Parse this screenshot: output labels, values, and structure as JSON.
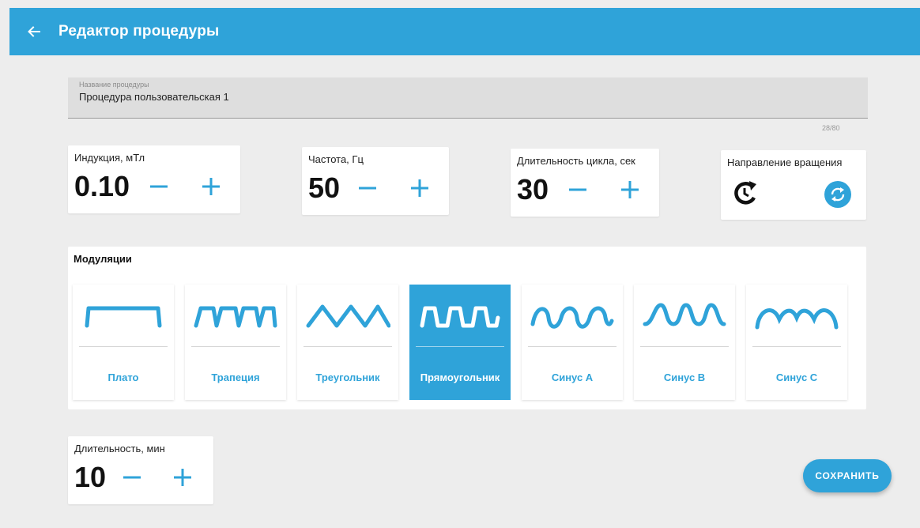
{
  "colors": {
    "accent": "#2fa3d9",
    "background": "#ededed",
    "card": "#ffffff"
  },
  "appbar": {
    "back_icon": "arrow-left-icon",
    "title": "Редактор процедуры"
  },
  "procedure_name": {
    "label": "Название процедуры",
    "value": "Процедура пользовательская 1",
    "counter": "28/80"
  },
  "params": {
    "induction": {
      "label": "Индукция, мТл",
      "value": "0.10",
      "minus": "−",
      "plus": "+"
    },
    "frequency": {
      "label": "Частота, Гц",
      "value": "50",
      "minus": "−",
      "plus": "+"
    },
    "cycle": {
      "label": "Длительность цикла, сек",
      "value": "30",
      "minus": "−",
      "plus": "+"
    },
    "rotation": {
      "label": "Направление вращения",
      "icons": [
        "rotate-clockwise-icon",
        "sync-icon"
      ]
    }
  },
  "modulations": {
    "title": "Модуляции",
    "items": [
      {
        "label": "Плато",
        "icon": "plateau-wave-icon",
        "selected": false
      },
      {
        "label": "Трапеция",
        "icon": "trapezoid-wave-icon",
        "selected": false
      },
      {
        "label": "Треугольник",
        "icon": "triangle-wave-icon",
        "selected": false
      },
      {
        "label": "Прямоугольник",
        "icon": "square-wave-icon",
        "selected": true
      },
      {
        "label": "Синус А",
        "icon": "sine-a-wave-icon",
        "selected": false
      },
      {
        "label": "Синус В",
        "icon": "sine-b-wave-icon",
        "selected": false
      },
      {
        "label": "Синус С",
        "icon": "sine-c-wave-icon",
        "selected": false
      }
    ]
  },
  "duration": {
    "label": "Длительность, мин",
    "value": "10",
    "minus": "−",
    "plus": "+"
  },
  "save_label": "СОХРАНИТЬ"
}
